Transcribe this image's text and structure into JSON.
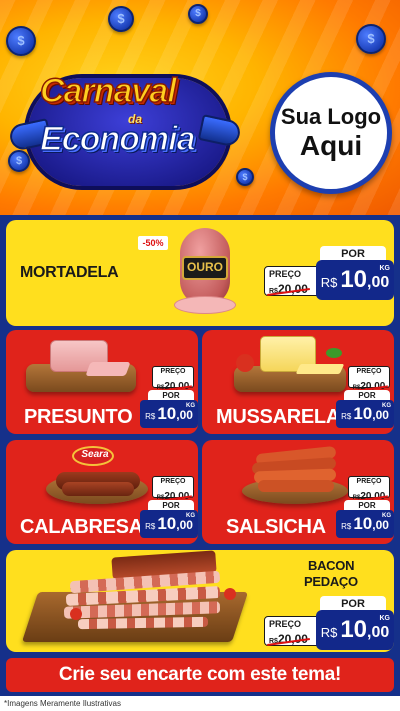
{
  "header": {
    "title_line1": "Carnaval",
    "title_da": "da",
    "title_line2": "Economia",
    "logo_line1": "Sua Logo",
    "logo_line2": "Aqui",
    "coin_symbol": "$"
  },
  "colors": {
    "brand_blue": "#12288a",
    "card_yellow": "#ffdf1e",
    "card_red": "#e0231b",
    "background": "#15308a"
  },
  "products": {
    "mortadela": {
      "name": "MORTADELA",
      "discount_badge": "-50%",
      "brand_label": "OURO",
      "old_label": "PREÇO",
      "old_currency": "R$",
      "old_value": "20,00",
      "por_label": "POR",
      "currency": "R$",
      "price_int": "10",
      "price_cents": ",00",
      "unit": "KG"
    },
    "presunto": {
      "name": "PRESUNTO",
      "old_label": "PREÇO",
      "old_currency": "R$",
      "old_value": "20,00",
      "por_label": "POR",
      "currency": "R$",
      "price_int": "10",
      "price_cents": ",00",
      "unit": "KG"
    },
    "mussarela": {
      "name": "MUSSARELA",
      "old_label": "PREÇO",
      "old_currency": "R$",
      "old_value": "20,00",
      "por_label": "POR",
      "currency": "R$",
      "price_int": "10",
      "price_cents": ",00",
      "unit": "KG"
    },
    "calabresa": {
      "name": "CALABRESA",
      "brand_label": "Seara",
      "old_label": "PREÇO",
      "old_currency": "R$",
      "old_value": "20,00",
      "por_label": "POR",
      "currency": "R$",
      "price_int": "10",
      "price_cents": ",00",
      "unit": "KG"
    },
    "salsicha": {
      "name": "SALSICHA",
      "old_label": "PREÇO",
      "old_currency": "R$",
      "old_value": "20,00",
      "por_label": "POR",
      "currency": "R$",
      "price_int": "10",
      "price_cents": ",00",
      "unit": "KG"
    },
    "bacon": {
      "name_line1": "BACON",
      "name_line2": "PEDAÇO",
      "old_label": "PREÇO",
      "old_currency": "R$",
      "old_value": "20,00",
      "por_label": "POR",
      "currency": "R$",
      "price_int": "10",
      "price_cents": ",00",
      "unit": "KG"
    }
  },
  "footer": {
    "cta_label": "Crie seu encarte com este tema!",
    "disclaimer": "*Imagens Meramente Ilustrativas"
  }
}
